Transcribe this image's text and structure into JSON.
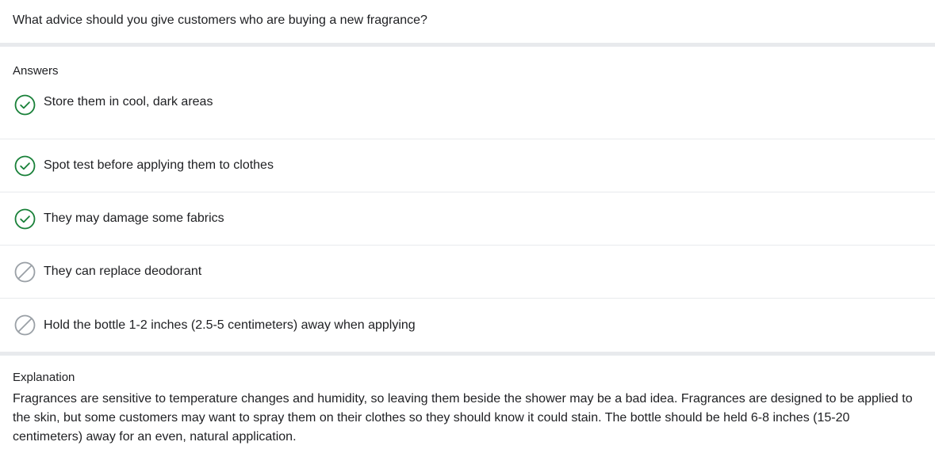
{
  "question": {
    "text": "What advice should you give customers who are buying a new fragrance?"
  },
  "answers": {
    "title": "Answers",
    "items": [
      {
        "label": "Store them in cool, dark areas",
        "status": "correct",
        "icon": "check-circle-icon"
      },
      {
        "label": "Spot test before applying them to clothes",
        "status": "correct",
        "icon": "check-circle-icon"
      },
      {
        "label": "They may damage some fabrics",
        "status": "correct",
        "icon": "check-circle-icon"
      },
      {
        "label": "They can replace deodorant",
        "status": "incorrect",
        "icon": "not-selected-icon"
      },
      {
        "label": "Hold the bottle 1-2 inches (2.5-5 centimeters) away when applying",
        "status": "incorrect",
        "icon": "not-selected-icon"
      }
    ]
  },
  "explanation": {
    "title": "Explanation",
    "text": "Fragrances are sensitive to temperature changes and humidity, so leaving them beside the shower may be a bad idea. Fragrances are designed to be applied to the skin, but some customers may want to spray them on their clothes so they should know it could stain. The bottle should be held 6-8 inches (15-20 centimeters) away for an even, natural application."
  },
  "colors": {
    "correct": "#188038",
    "incorrect": "#9aa0a6",
    "divider": "#e8eaed",
    "text": "#202124"
  }
}
